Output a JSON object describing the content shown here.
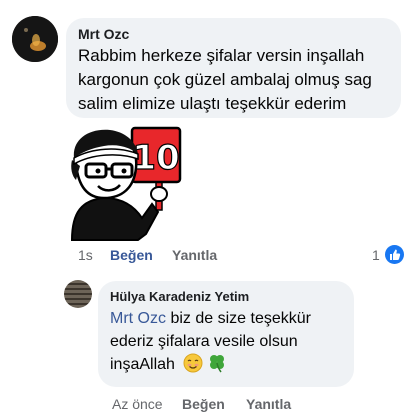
{
  "comments": [
    {
      "author": "Mrt Ozc",
      "text": "Rabbim herkeze şifalar versin inşallah\nkargonun çok güzel ambalaj olmuş sag\nsalim elimize ulaştı teşekkür ederim",
      "sticker": {
        "icon": "cartoon-man-holding-10-sign-icon",
        "sign_text": "10"
      },
      "time": "1s",
      "like_label": "Beğen",
      "reply_label": "Yanıtla",
      "reaction_count": "1",
      "reaction_icon": "like-reaction-icon"
    },
    {
      "author": "Hülya Karadeniz Yetim",
      "mention": "Mrt Ozc",
      "text_line1": "biz de size teşekkür",
      "text_line2": "ederiz şifalara vesile olsun",
      "text_line3": "inşaAllah",
      "emojis": [
        "smiling-face-icon",
        "four-leaf-clover-icon"
      ],
      "time": "Az önce",
      "like_label": "Beğen",
      "reply_label": "Yanıtla"
    }
  ],
  "colors": {
    "bubble": "#eff2f5",
    "link": "#385898",
    "meta": "#65676b",
    "like_badge": "#1877f2",
    "sign_red": "#e8272b"
  }
}
